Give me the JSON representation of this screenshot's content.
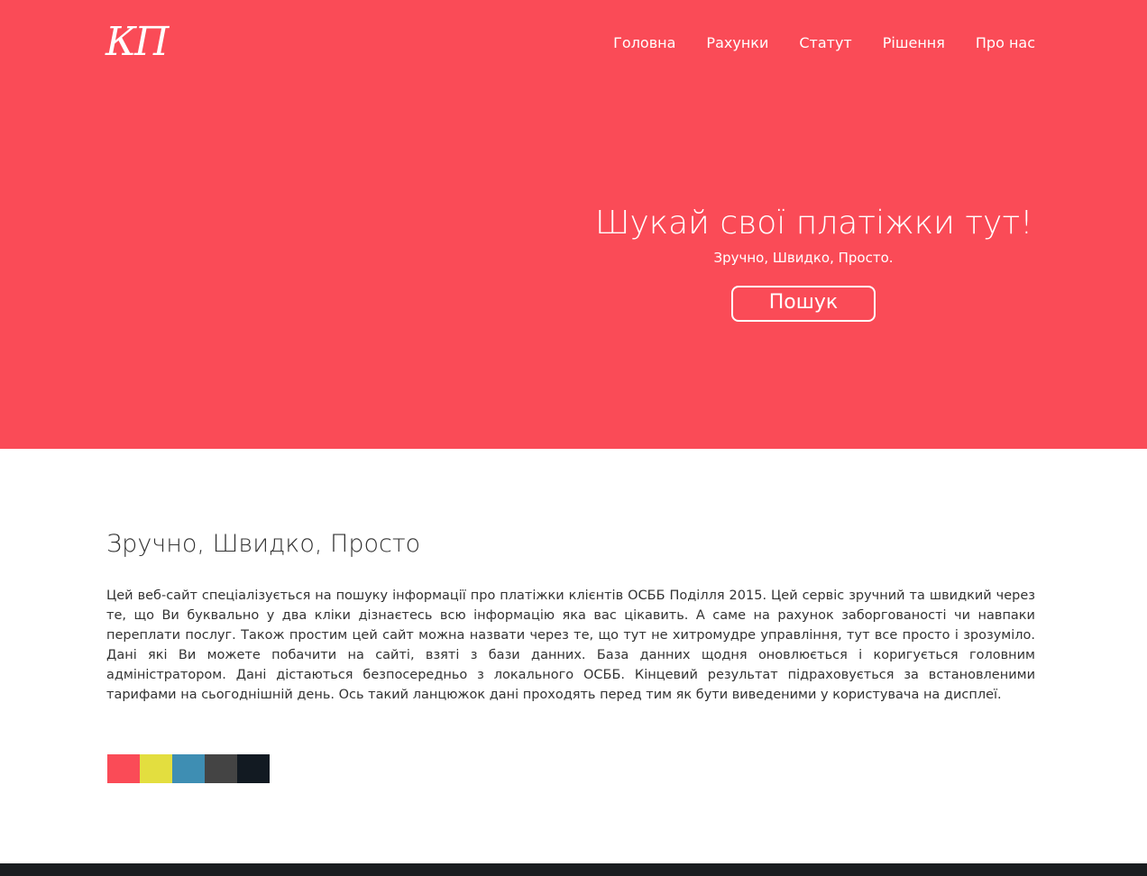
{
  "header": {
    "logo": "КП",
    "nav": [
      "Головна",
      "Рахунки",
      "Статут",
      "Рішення",
      "Про нас"
    ]
  },
  "hero": {
    "title": "Шукай свої платіжки тут!",
    "subtitle": "Зручно, Швидко, Просто.",
    "button_label": "Пошук"
  },
  "about": {
    "title": "Зручно, Швидко, Просто",
    "body": "Цей веб-сайт спеціалізується на пошуку інформації про платіжки клієнтів ОСББ Поділля 2015. Цей сервіс зручний та швидкий через те, що Ви буквально у два кліки дізнаєтесь всю інформацію яка вас цікавить. А саме на рахунок заборгованості чи навпаки переплати послуг. Також простим цей сайт можна назвати через те, що тут не хитромудре управління, тут все просто і зрозуміло. Дані які Ви можете побачити на сайті, взяті з бази данних. База данних щодня оновлюється і коригується головним адміністратором. Дані дістаються безпосередньо з локального ОСББ. Кінцевий результат підраховується за встановленими тарифами на сьогоднішній день. Ось такий ланцюжок дані проходять перед тим як бути виведеними у користувача на дисплеї."
  },
  "palette": [
    "#fa4b57",
    "#e3de3f",
    "#3e8eb3",
    "#444444",
    "#121a22"
  ],
  "colors": {
    "accent": "#fa4b57",
    "footer": "#1a1d20"
  }
}
